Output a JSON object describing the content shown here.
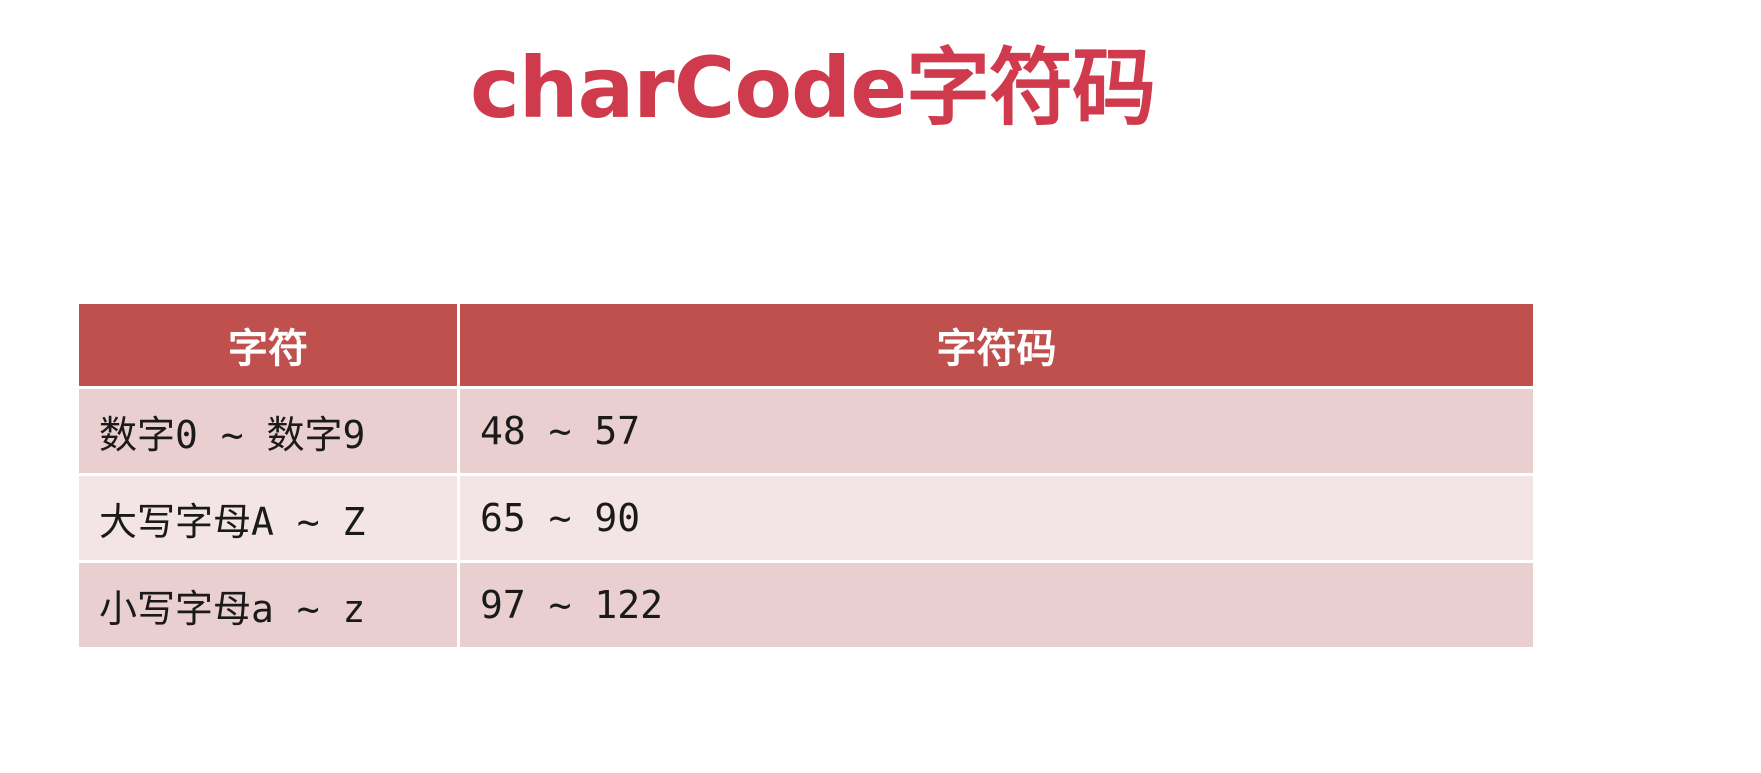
{
  "title": "charCode字符码",
  "colors": {
    "title": "#cf3a4c",
    "header_bg": "#c0504d",
    "row_odd_bg": "#e9cfd0",
    "row_even_bg": "#f3e5e5"
  },
  "table": {
    "headers": [
      "字符",
      "字符码"
    ],
    "rows": [
      [
        "数字0 ~ 数字9",
        "48 ~ 57"
      ],
      [
        "大写字母A ~ Z",
        "65 ~ 90"
      ],
      [
        "小写字母a ~ z",
        "97 ~ 122"
      ]
    ]
  }
}
